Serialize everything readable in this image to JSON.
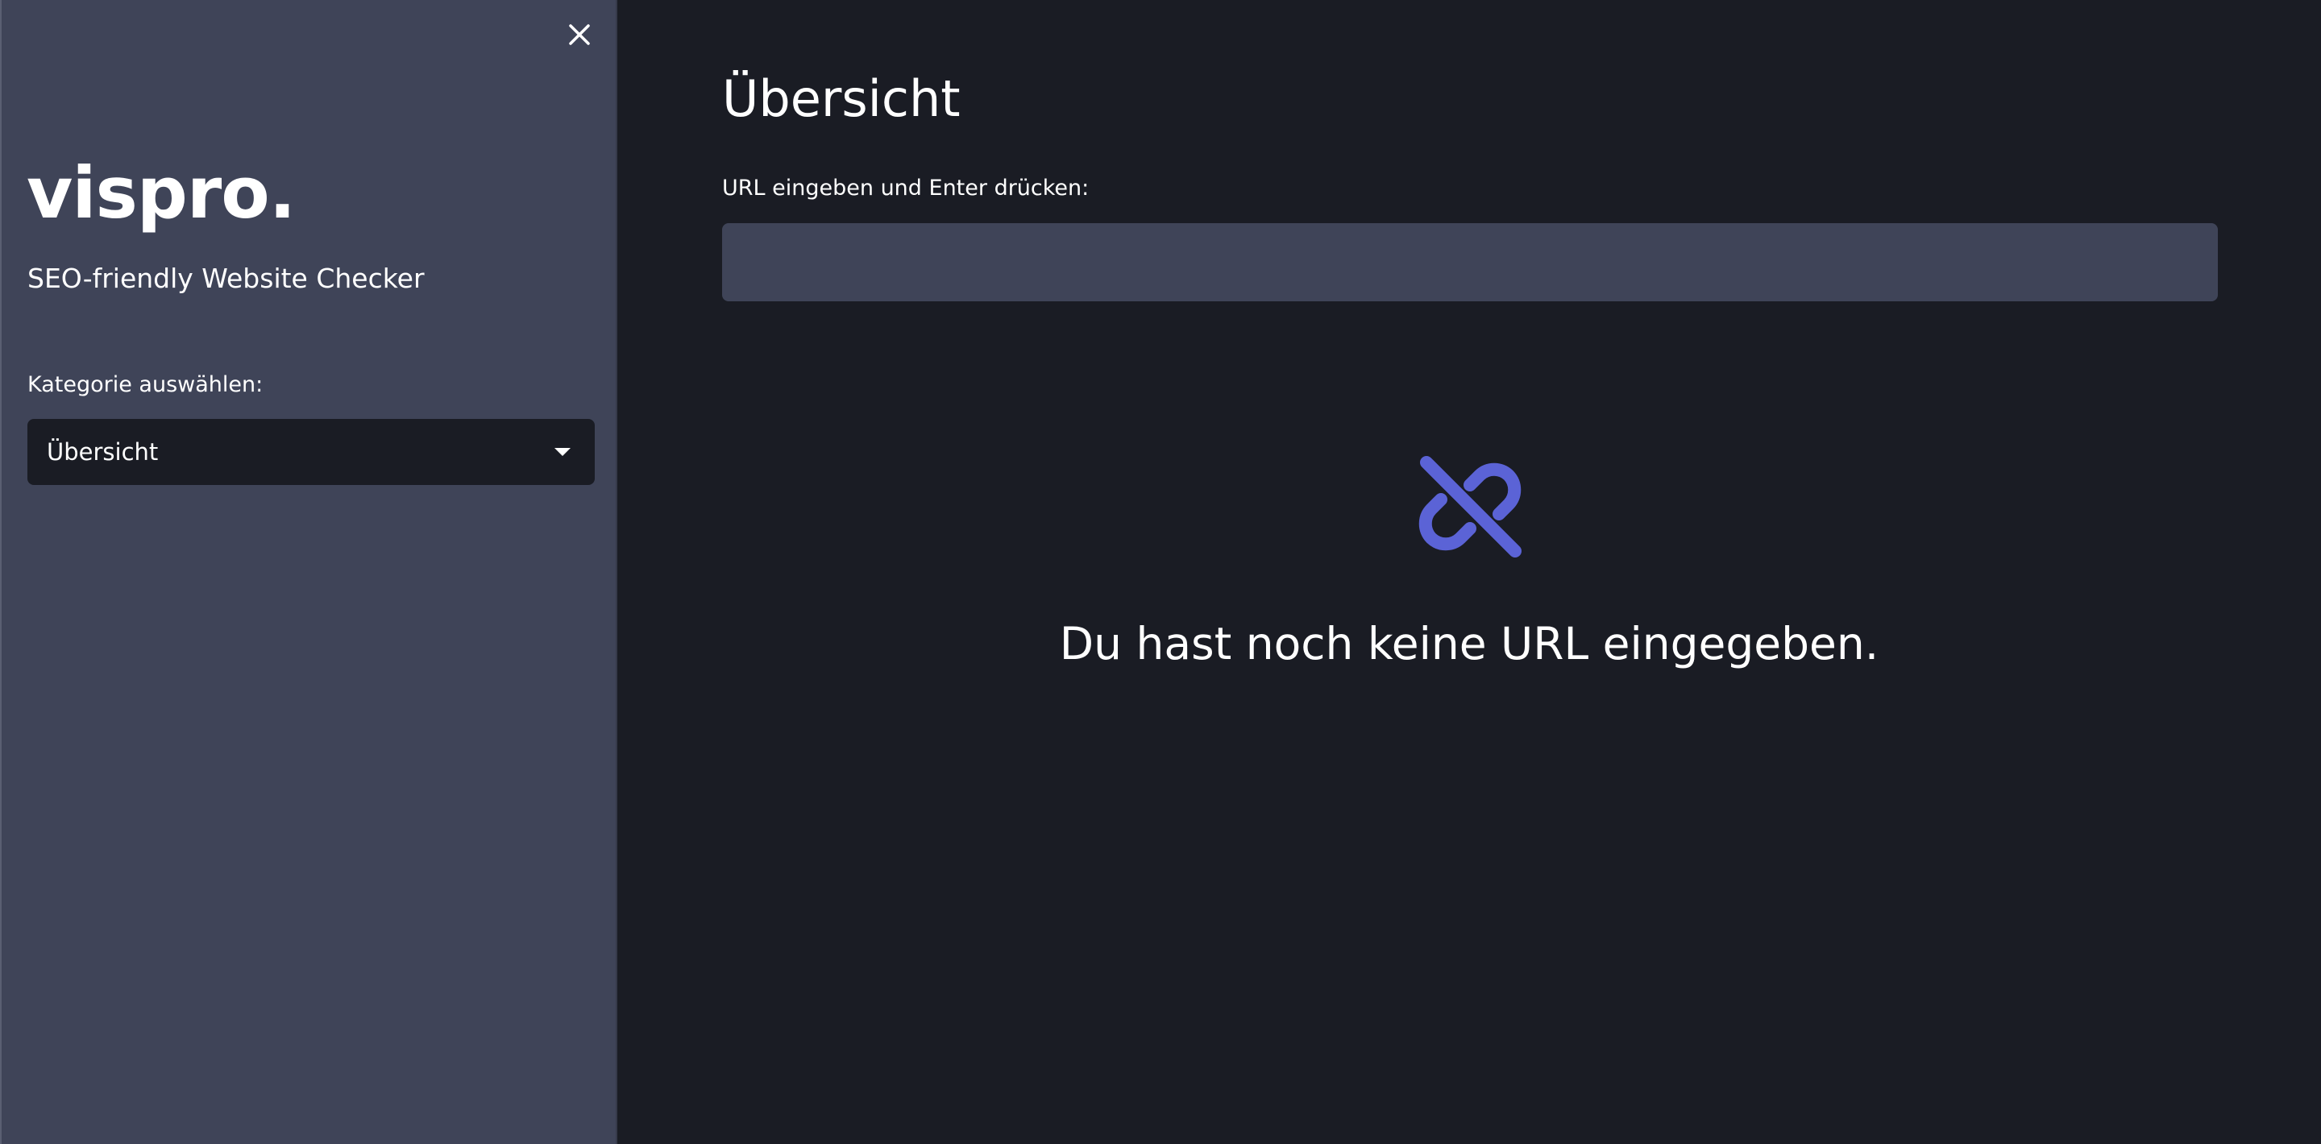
{
  "sidebar": {
    "close_icon": "close-icon",
    "brand": "vispro.",
    "tagline": "SEO-friendly Website Checker",
    "category_label": "Kategorie auswählen:",
    "category_selected": "Übersicht",
    "caret_icon": "caret-down-icon"
  },
  "main": {
    "title": "Übersicht",
    "url_label": "URL eingeben und Enter drücken:",
    "url_value": "",
    "empty_icon": "link-off-icon",
    "empty_message": "Du hast noch keine URL eingegeben."
  },
  "colors": {
    "sidebar_bg": "#3f4458",
    "main_bg": "#1a1c24",
    "input_bg": "#3f4458",
    "accent": "#5b63d6",
    "text": "#ffffff"
  }
}
